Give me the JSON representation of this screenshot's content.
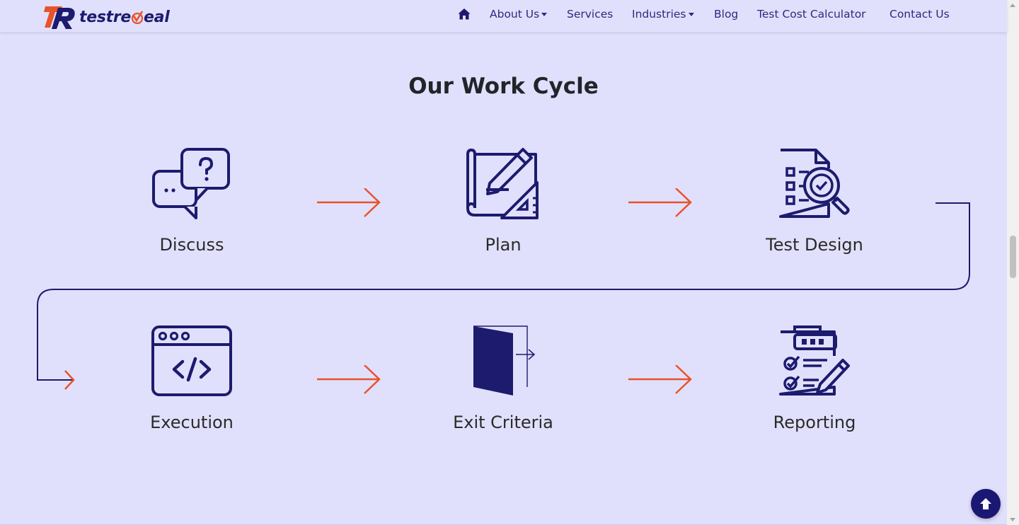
{
  "brand": {
    "name": "testreveal",
    "name_prefix": "testre",
    "name_suffix": "eal",
    "logo_initials": "TR"
  },
  "nav": {
    "home_icon": "home-icon",
    "items": [
      {
        "label": "About Us",
        "dropdown": true
      },
      {
        "label": "Services",
        "dropdown": false
      },
      {
        "label": "Industries",
        "dropdown": true
      },
      {
        "label": "Blog",
        "dropdown": false
      },
      {
        "label": "Test Cost Calculator",
        "dropdown": false
      },
      {
        "label": "Contact Us",
        "dropdown": false
      }
    ]
  },
  "section": {
    "title": "Our Work Cycle",
    "steps": [
      {
        "label": "Discuss",
        "icon": "chat-question-icon"
      },
      {
        "label": "Plan",
        "icon": "blueprint-pencil-icon"
      },
      {
        "label": "Test Design",
        "icon": "document-magnifier-icon"
      },
      {
        "label": "Execution",
        "icon": "code-window-icon"
      },
      {
        "label": "Exit Criteria",
        "icon": "exit-door-icon"
      },
      {
        "label": "Reporting",
        "icon": "clipboard-checklist-icon"
      }
    ]
  },
  "back_to_top_icon": "arrow-up-icon",
  "colors": {
    "background": "#e1e0fc",
    "primary": "#1c1b6e",
    "accent": "#e8532a",
    "title": "#212529"
  }
}
